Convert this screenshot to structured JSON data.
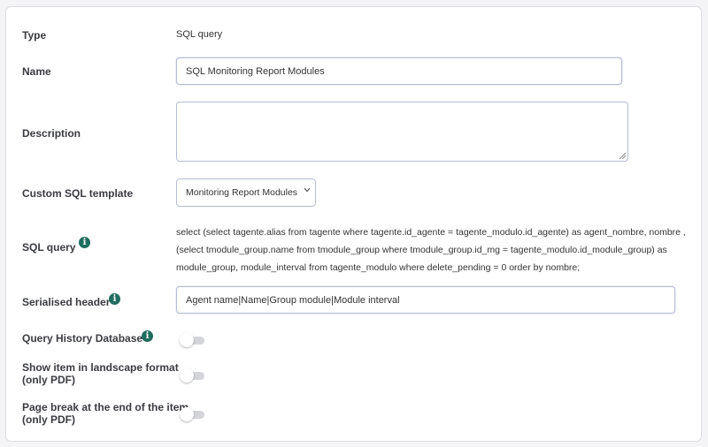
{
  "form": {
    "type": {
      "label": "Type",
      "value": "SQL query"
    },
    "name": {
      "label": "Name",
      "value": "SQL Monitoring Report Modules"
    },
    "description": {
      "label": "Description",
      "value": ""
    },
    "custom_sql_template": {
      "label": "Custom SQL template",
      "selected": "Monitoring Report Modules"
    },
    "sql_query": {
      "label": "SQL query",
      "value": "select (select tagente.alias from tagente where tagente.id_agente = tagente_modulo.id_agente) as agent_nombre, nombre , (select tmodule_group.name from tmodule_group where tmodule_group.id_mg = tagente_modulo.id_module_group) as module_group, module_interval from tagente_modulo where delete_pending = 0 order by nombre;"
    },
    "serialised_header": {
      "label": "Serialised header",
      "value": "Agent name|Name|Group module|Module interval"
    },
    "query_history_db": {
      "label": "Query History Database",
      "enabled": false
    },
    "landscape": {
      "label_line1": "Show item in landscape format",
      "label_line2": "(only PDF)",
      "enabled": false
    },
    "page_break": {
      "label_line1": "Page break at the end of the item",
      "label_line2": "(only PDF)",
      "enabled": false
    }
  },
  "icons": {
    "info": "info-icon",
    "chevron": "chevron-down-icon"
  },
  "colors": {
    "info_icon": "#1f6d5f",
    "input_border": "#b6bcd6",
    "toggle_off": "#d4d5d9"
  }
}
